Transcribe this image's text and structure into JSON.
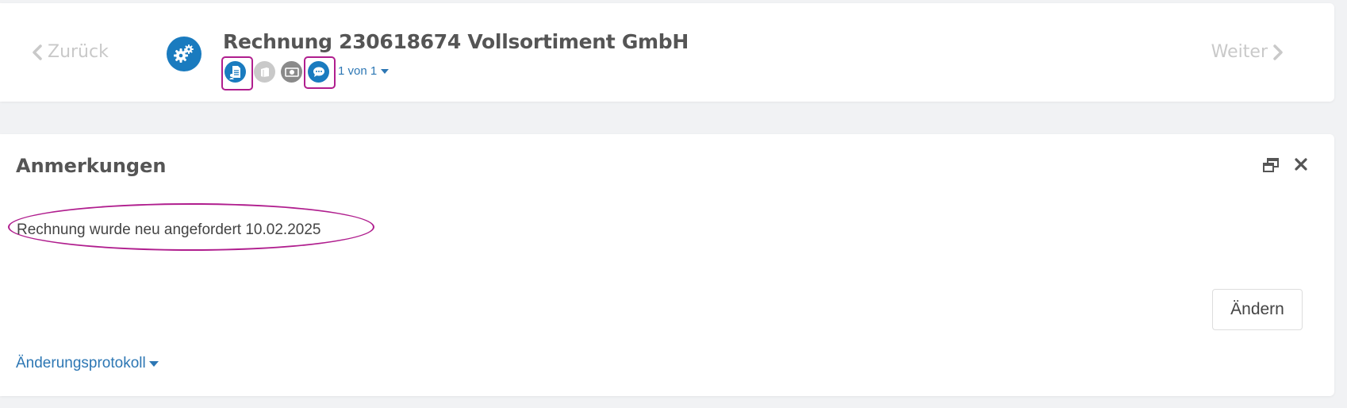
{
  "header": {
    "back_label": "Zurück",
    "next_label": "Weiter",
    "title": "Rechnung 230618674 Vollsortiment GmbH",
    "pager": "1 von 1",
    "icons": [
      "gears-icon",
      "document-user-icon",
      "book-icon",
      "money-icon",
      "chat-icon"
    ],
    "colors": {
      "accent": "#1a7bbf",
      "highlight": "#b01e8e",
      "inactive": "#c9c9c9"
    }
  },
  "notes": {
    "title": "Anmerkungen",
    "text": "Rechnung wurde neu angefordert 10.02.2025",
    "edit_label": "Ändern",
    "changelog_label": "Änderungsprotokoll"
  }
}
